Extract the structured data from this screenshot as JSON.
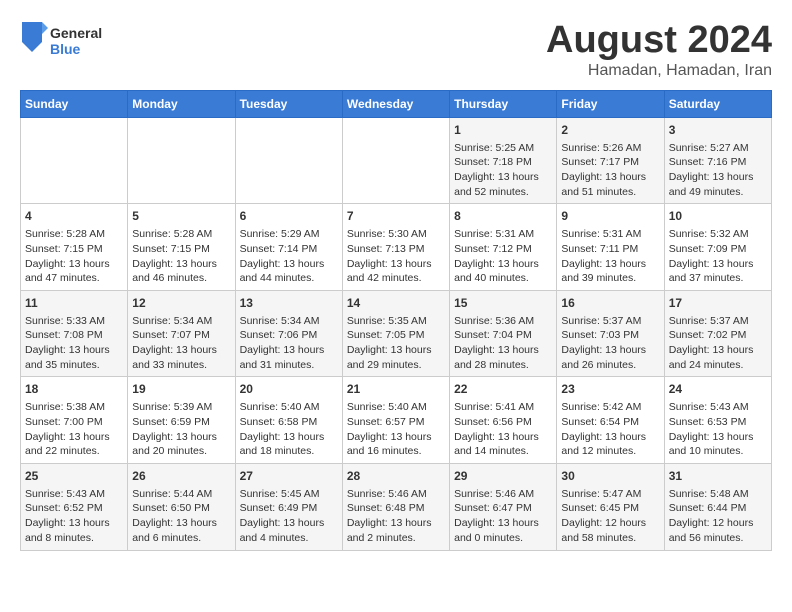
{
  "logo": {
    "general": "General",
    "blue": "Blue"
  },
  "title": "August 2024",
  "subtitle": "Hamadan, Hamadan, Iran",
  "days_of_week": [
    "Sunday",
    "Monday",
    "Tuesday",
    "Wednesday",
    "Thursday",
    "Friday",
    "Saturday"
  ],
  "weeks": [
    [
      {
        "day": "",
        "info": ""
      },
      {
        "day": "",
        "info": ""
      },
      {
        "day": "",
        "info": ""
      },
      {
        "day": "",
        "info": ""
      },
      {
        "day": "1",
        "info": "Sunrise: 5:25 AM\nSunset: 7:18 PM\nDaylight: 13 hours\nand 52 minutes."
      },
      {
        "day": "2",
        "info": "Sunrise: 5:26 AM\nSunset: 7:17 PM\nDaylight: 13 hours\nand 51 minutes."
      },
      {
        "day": "3",
        "info": "Sunrise: 5:27 AM\nSunset: 7:16 PM\nDaylight: 13 hours\nand 49 minutes."
      }
    ],
    [
      {
        "day": "4",
        "info": "Sunrise: 5:28 AM\nSunset: 7:15 PM\nDaylight: 13 hours\nand 47 minutes."
      },
      {
        "day": "5",
        "info": "Sunrise: 5:28 AM\nSunset: 7:15 PM\nDaylight: 13 hours\nand 46 minutes."
      },
      {
        "day": "6",
        "info": "Sunrise: 5:29 AM\nSunset: 7:14 PM\nDaylight: 13 hours\nand 44 minutes."
      },
      {
        "day": "7",
        "info": "Sunrise: 5:30 AM\nSunset: 7:13 PM\nDaylight: 13 hours\nand 42 minutes."
      },
      {
        "day": "8",
        "info": "Sunrise: 5:31 AM\nSunset: 7:12 PM\nDaylight: 13 hours\nand 40 minutes."
      },
      {
        "day": "9",
        "info": "Sunrise: 5:31 AM\nSunset: 7:11 PM\nDaylight: 13 hours\nand 39 minutes."
      },
      {
        "day": "10",
        "info": "Sunrise: 5:32 AM\nSunset: 7:09 PM\nDaylight: 13 hours\nand 37 minutes."
      }
    ],
    [
      {
        "day": "11",
        "info": "Sunrise: 5:33 AM\nSunset: 7:08 PM\nDaylight: 13 hours\nand 35 minutes."
      },
      {
        "day": "12",
        "info": "Sunrise: 5:34 AM\nSunset: 7:07 PM\nDaylight: 13 hours\nand 33 minutes."
      },
      {
        "day": "13",
        "info": "Sunrise: 5:34 AM\nSunset: 7:06 PM\nDaylight: 13 hours\nand 31 minutes."
      },
      {
        "day": "14",
        "info": "Sunrise: 5:35 AM\nSunset: 7:05 PM\nDaylight: 13 hours\nand 29 minutes."
      },
      {
        "day": "15",
        "info": "Sunrise: 5:36 AM\nSunset: 7:04 PM\nDaylight: 13 hours\nand 28 minutes."
      },
      {
        "day": "16",
        "info": "Sunrise: 5:37 AM\nSunset: 7:03 PM\nDaylight: 13 hours\nand 26 minutes."
      },
      {
        "day": "17",
        "info": "Sunrise: 5:37 AM\nSunset: 7:02 PM\nDaylight: 13 hours\nand 24 minutes."
      }
    ],
    [
      {
        "day": "18",
        "info": "Sunrise: 5:38 AM\nSunset: 7:00 PM\nDaylight: 13 hours\nand 22 minutes."
      },
      {
        "day": "19",
        "info": "Sunrise: 5:39 AM\nSunset: 6:59 PM\nDaylight: 13 hours\nand 20 minutes."
      },
      {
        "day": "20",
        "info": "Sunrise: 5:40 AM\nSunset: 6:58 PM\nDaylight: 13 hours\nand 18 minutes."
      },
      {
        "day": "21",
        "info": "Sunrise: 5:40 AM\nSunset: 6:57 PM\nDaylight: 13 hours\nand 16 minutes."
      },
      {
        "day": "22",
        "info": "Sunrise: 5:41 AM\nSunset: 6:56 PM\nDaylight: 13 hours\nand 14 minutes."
      },
      {
        "day": "23",
        "info": "Sunrise: 5:42 AM\nSunset: 6:54 PM\nDaylight: 13 hours\nand 12 minutes."
      },
      {
        "day": "24",
        "info": "Sunrise: 5:43 AM\nSunset: 6:53 PM\nDaylight: 13 hours\nand 10 minutes."
      }
    ],
    [
      {
        "day": "25",
        "info": "Sunrise: 5:43 AM\nSunset: 6:52 PM\nDaylight: 13 hours\nand 8 minutes."
      },
      {
        "day": "26",
        "info": "Sunrise: 5:44 AM\nSunset: 6:50 PM\nDaylight: 13 hours\nand 6 minutes."
      },
      {
        "day": "27",
        "info": "Sunrise: 5:45 AM\nSunset: 6:49 PM\nDaylight: 13 hours\nand 4 minutes."
      },
      {
        "day": "28",
        "info": "Sunrise: 5:46 AM\nSunset: 6:48 PM\nDaylight: 13 hours\nand 2 minutes."
      },
      {
        "day": "29",
        "info": "Sunrise: 5:46 AM\nSunset: 6:47 PM\nDaylight: 13 hours\nand 0 minutes."
      },
      {
        "day": "30",
        "info": "Sunrise: 5:47 AM\nSunset: 6:45 PM\nDaylight: 12 hours\nand 58 minutes."
      },
      {
        "day": "31",
        "info": "Sunrise: 5:48 AM\nSunset: 6:44 PM\nDaylight: 12 hours\nand 56 minutes."
      }
    ]
  ]
}
